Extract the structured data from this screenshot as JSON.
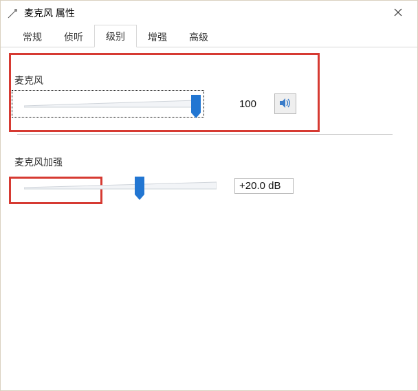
{
  "window": {
    "title": "麦克风 属性"
  },
  "tabs": {
    "general": "常规",
    "listen": "侦听",
    "levels": "级别",
    "enhance": "增强",
    "advanced": "高级",
    "active": "levels"
  },
  "mic": {
    "label": "麦克风",
    "value": "100",
    "percent": 100
  },
  "boost": {
    "label": "麦克风加强",
    "value": "+20.0 dB",
    "percent": 60
  },
  "icons": {
    "close": "close-icon",
    "app": "microphone-app-icon",
    "speaker": "speaker-icon"
  },
  "colors": {
    "accent": "#2276d2",
    "highlight": "#d63a32"
  }
}
